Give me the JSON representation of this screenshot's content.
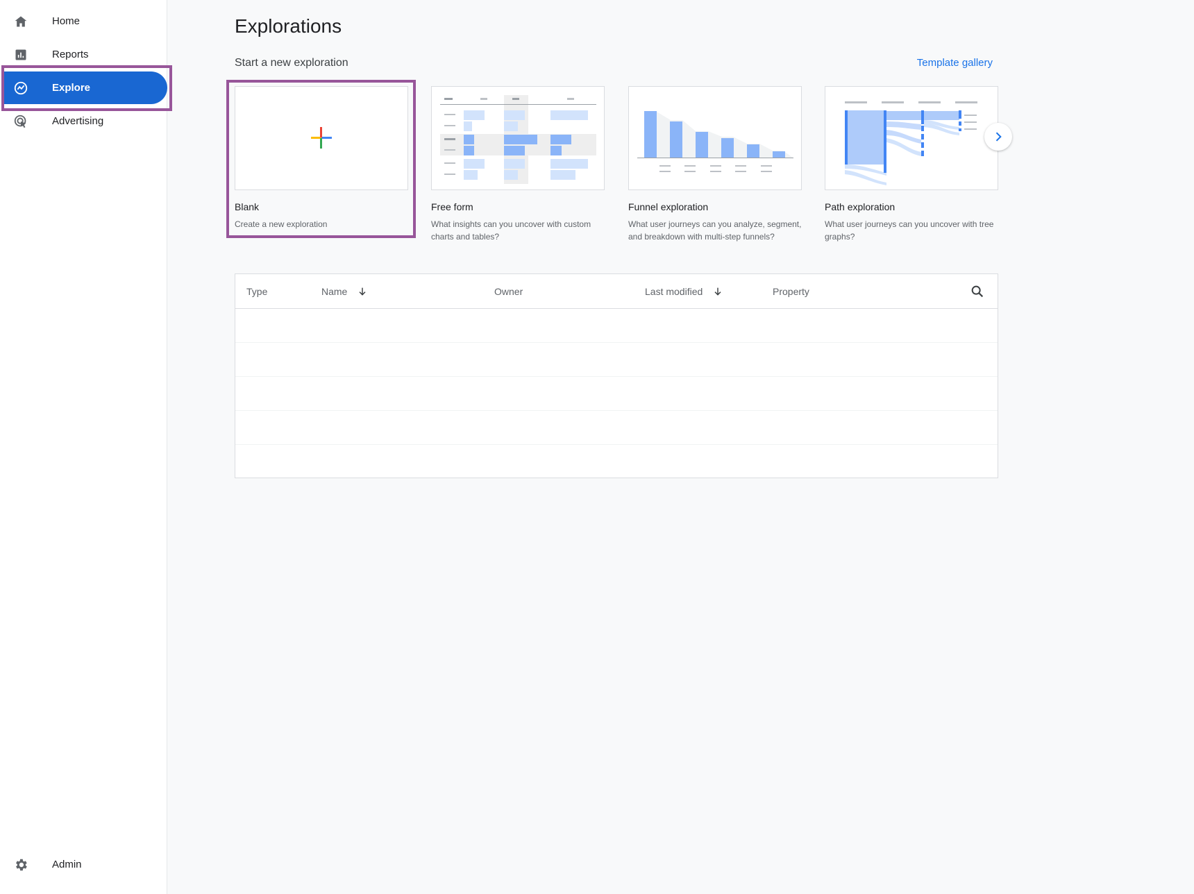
{
  "sidebar": {
    "items": [
      {
        "label": "Home",
        "icon": "home-icon"
      },
      {
        "label": "Reports",
        "icon": "reports-icon"
      },
      {
        "label": "Explore",
        "icon": "explore-icon",
        "active": true
      },
      {
        "label": "Advertising",
        "icon": "advertising-icon"
      }
    ],
    "admin": {
      "label": "Admin",
      "icon": "gear-icon"
    }
  },
  "page": {
    "title": "Explorations",
    "subtitle": "Start a new exploration",
    "template_gallery_label": "Template gallery"
  },
  "cards": [
    {
      "title": "Blank",
      "desc": "Create a new exploration"
    },
    {
      "title": "Free form",
      "desc": "What insights can you uncover with custom charts and tables?"
    },
    {
      "title": "Funnel exploration",
      "desc": "What user journeys can you analyze, segment, and breakdown with multi-step funnels?"
    },
    {
      "title": "Path exploration",
      "desc": "What user journeys can you uncover with tree graphs?"
    }
  ],
  "table": {
    "columns": {
      "type": "Type",
      "name": "Name",
      "owner": "Owner",
      "last_modified": "Last modified",
      "property": "Property"
    },
    "rows": []
  },
  "colors": {
    "accent": "#1967d2",
    "link": "#1a73e8",
    "highlight_outline": "#98569a"
  }
}
